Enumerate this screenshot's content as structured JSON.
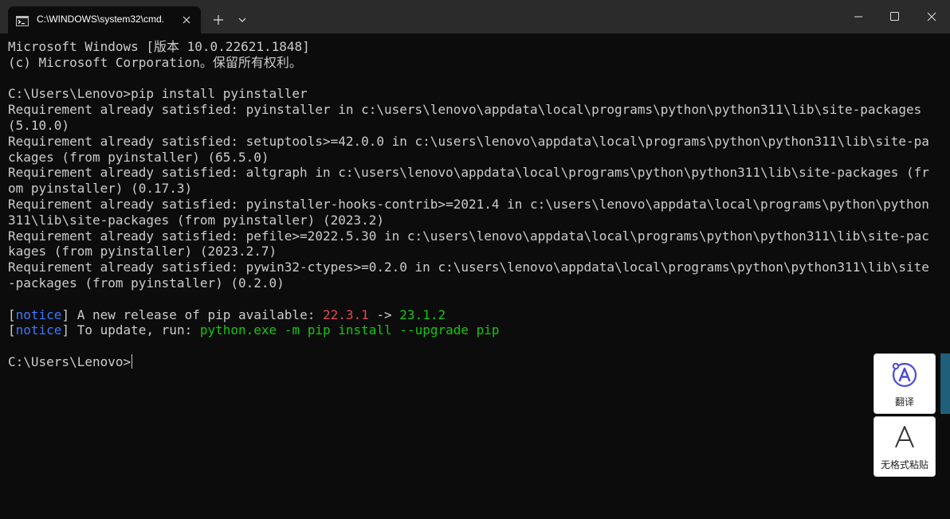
{
  "window": {
    "tab_title": "C:\\WINDOWS\\system32\\cmd.",
    "icons": {
      "tab": "cmd-console-icon",
      "close_tab": "close-icon",
      "new_tab": "plus-icon",
      "dropdown": "chevron-down-icon",
      "minimize": "minimize-icon",
      "maximize": "maximize-icon",
      "close": "close-icon"
    }
  },
  "terminal": {
    "line1": "Microsoft Windows [版本 10.0.22621.1848]",
    "line2": "(c) Microsoft Corporation。保留所有权利。",
    "prompt1": "C:\\Users\\Lenovo>pip install pyinstaller",
    "req1a": "Requirement already satisfied: pyinstaller in c:\\users\\lenovo\\appdata\\local\\programs\\python\\python311\\lib\\site-packages",
    "req1b": "(5.10.0)",
    "req2a": "Requirement already satisfied: setuptools>=42.0.0 in c:\\users\\lenovo\\appdata\\local\\programs\\python\\python311\\lib\\site-pa",
    "req2b": "ckages (from pyinstaller) (65.5.0)",
    "req3a": "Requirement already satisfied: altgraph in c:\\users\\lenovo\\appdata\\local\\programs\\python\\python311\\lib\\site-packages (fr",
    "req3b": "om pyinstaller) (0.17.3)",
    "req4a": "Requirement already satisfied: pyinstaller-hooks-contrib>=2021.4 in c:\\users\\lenovo\\appdata\\local\\programs\\python\\python",
    "req4b": "311\\lib\\site-packages (from pyinstaller) (2023.2)",
    "req5a": "Requirement already satisfied: pefile>=2022.5.30 in c:\\users\\lenovo\\appdata\\local\\programs\\python\\python311\\lib\\site-pac",
    "req5b": "kages (from pyinstaller) (2023.2.7)",
    "req6a": "Requirement already satisfied: pywin32-ctypes>=0.2.0 in c:\\users\\lenovo\\appdata\\local\\programs\\python\\python311\\lib\\site",
    "req6b": "-packages (from pyinstaller) (0.2.0)",
    "notice1": {
      "open": "[",
      "tag": "notice",
      "close": "]",
      "text": " A new release of pip available: ",
      "old_version": "22.3.1",
      "arrow": " -> ",
      "new_version": "23.1.2"
    },
    "notice2": {
      "open": "[",
      "tag": "notice",
      "close": "]",
      "text": " To update, run: ",
      "command": "python.exe -m pip install --upgrade pip"
    },
    "prompt2": "C:\\Users\\Lenovo>"
  },
  "side_panel": {
    "translate_label": "翻译",
    "translate_icon": "translate-icon",
    "paste_label": "无格式粘贴",
    "paste_icon": "plain-text-paste-icon"
  },
  "colors": {
    "background": "#0c0c0c",
    "titlebar": "#2b2b2b",
    "text": "#cccccc",
    "notice_tag": "#3b78ff",
    "old_version": "#e74856",
    "new_version": "#16c60c",
    "accent": "#4b4bd8"
  }
}
